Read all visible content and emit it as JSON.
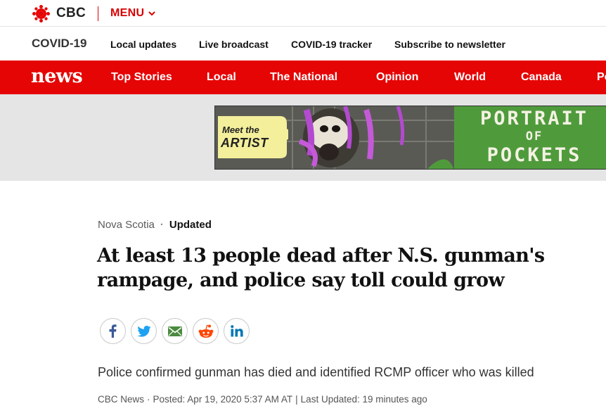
{
  "topbar": {
    "brand": "CBC",
    "menu_label": "MENU"
  },
  "subnav": {
    "section": "COVID-19",
    "links": [
      "Local updates",
      "Live broadcast",
      "COVID-19 tracker",
      "Subscribe to newsletter"
    ]
  },
  "newsbar": {
    "logo": "news",
    "links": [
      "Top Stories",
      "Local",
      "The National",
      "Opinion",
      "World",
      "Canada",
      "Po"
    ]
  },
  "ad": {
    "meet": "Meet the",
    "artist": "ARTIST",
    "title_line1": "PORTRAIT",
    "title_line2": "OF",
    "title_line3": "POCKETS"
  },
  "article": {
    "section": "Nova Scotia",
    "separator": "·",
    "status": "Updated",
    "headline": "At least 13 people dead after N.S. gunman's rampage, and police say toll could grow",
    "deck": "Police confirmed gunman has died and identified RCMP officer who was killed",
    "byline": {
      "source": "CBC News",
      "sep1": "·",
      "posted": "Posted: Apr 19, 2020 5:37 AM AT",
      "sep2": "|",
      "updated": "Last Updated: 19 minutes ago"
    }
  },
  "share": {
    "icons": [
      "facebook-icon",
      "twitter-icon",
      "email-icon",
      "reddit-icon",
      "linkedin-icon"
    ]
  },
  "colors": {
    "cbc_red": "#e60505",
    "facebook": "#3b5998",
    "twitter": "#1da1f2",
    "email": "#4a8a3e",
    "reddit": "#ff4500",
    "linkedin": "#0077b5"
  }
}
